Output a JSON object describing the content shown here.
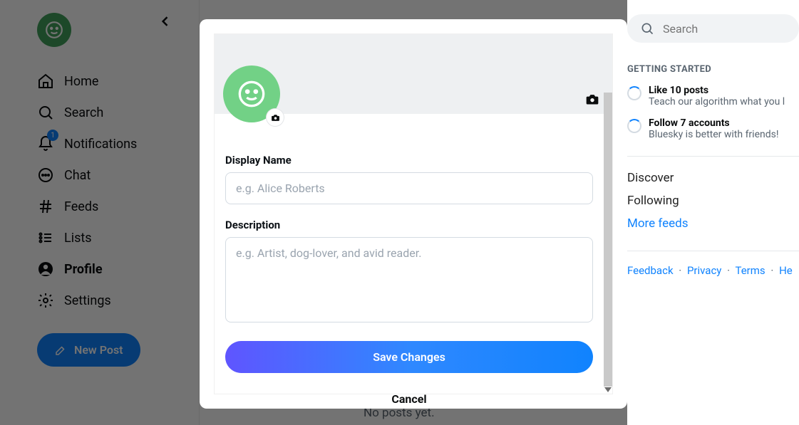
{
  "sidebar": {
    "items": [
      {
        "label": "Home"
      },
      {
        "label": "Search"
      },
      {
        "label": "Notifications",
        "badge": "1"
      },
      {
        "label": "Chat"
      },
      {
        "label": "Feeds"
      },
      {
        "label": "Lists"
      },
      {
        "label": "Profile"
      },
      {
        "label": "Settings"
      }
    ],
    "new_post": "New Post"
  },
  "center": {
    "no_posts": "No posts yet."
  },
  "right": {
    "search_placeholder": "Search",
    "getting_started_header": "GETTING STARTED",
    "tasks": [
      {
        "title": "Like 10 posts",
        "sub": "Teach our algorithm what you l"
      },
      {
        "title": "Follow 7 accounts",
        "sub": "Bluesky is better with friends!"
      }
    ],
    "feeds": [
      {
        "label": "Discover"
      },
      {
        "label": "Following"
      },
      {
        "label": "More feeds"
      }
    ],
    "footer": {
      "feedback": "Feedback",
      "privacy": "Privacy",
      "terms": "Terms",
      "help": "He"
    }
  },
  "modal": {
    "display_name_label": "Display Name",
    "display_name_placeholder": "e.g. Alice Roberts",
    "description_label": "Description",
    "description_placeholder": "e.g. Artist, dog-lover, and avid reader.",
    "save": "Save Changes",
    "cancel": "Cancel"
  }
}
